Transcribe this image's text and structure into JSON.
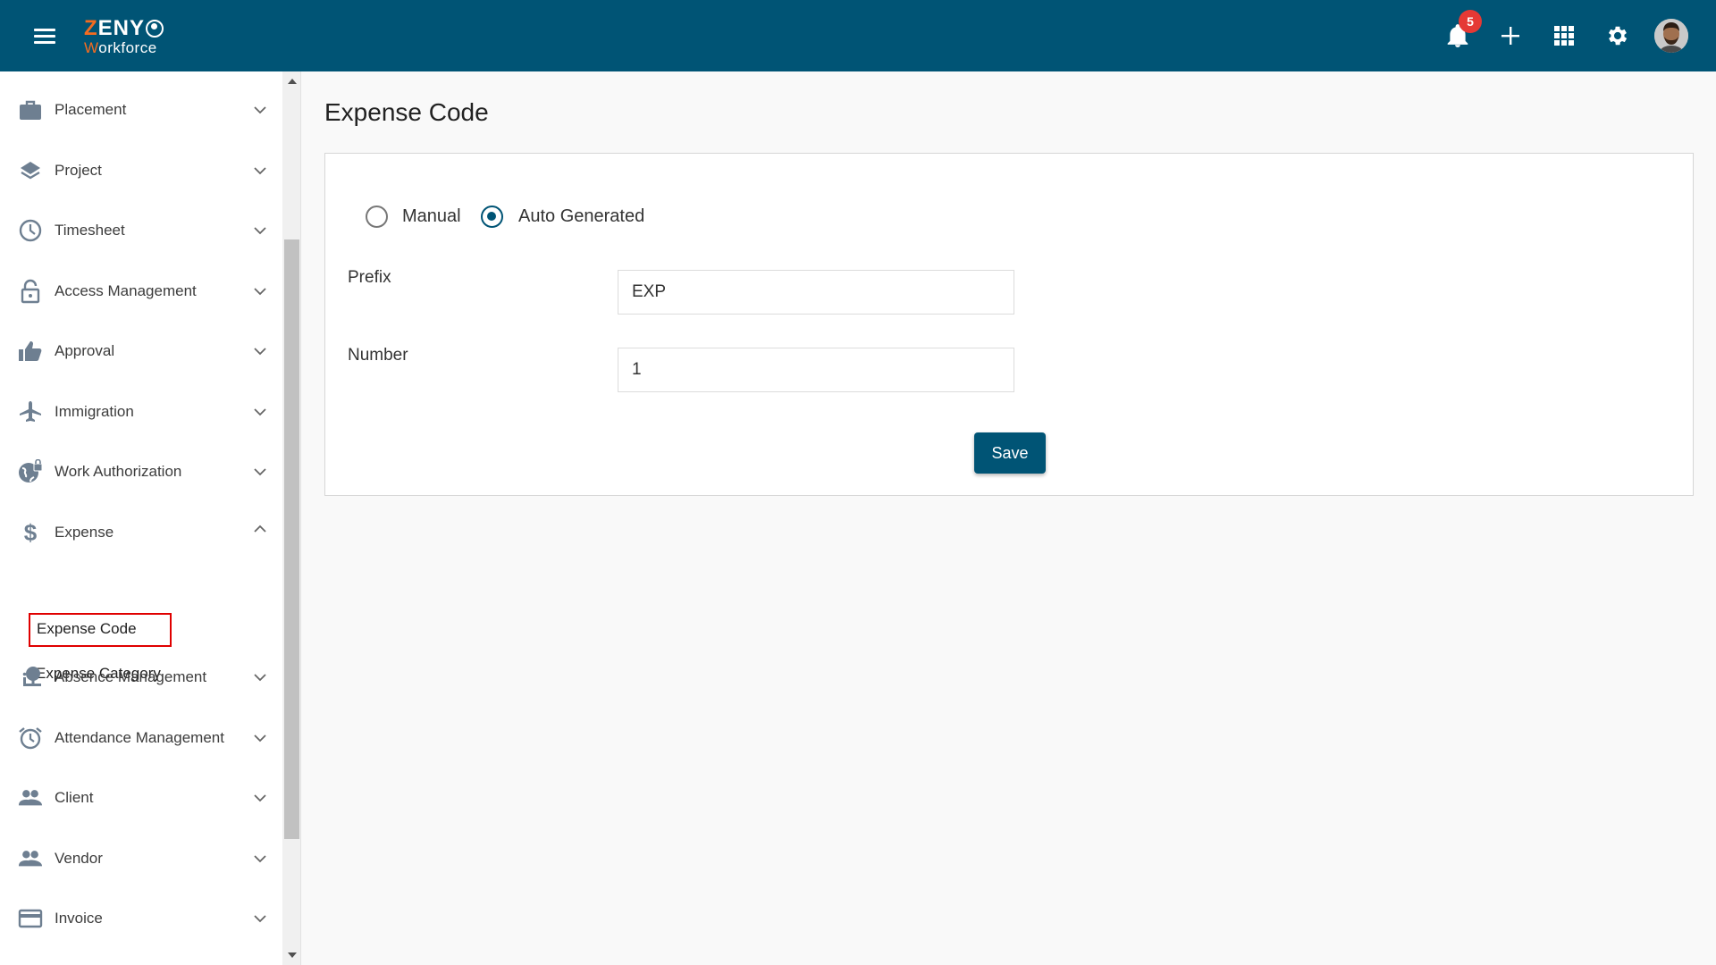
{
  "header": {
    "logo_top_accent": "Z",
    "logo_top_rest": "ENY",
    "logo_bottom_accent": "W",
    "logo_bottom_rest": "orkforce",
    "notification_count": "5",
    "icons": [
      "menu-icon",
      "bell-icon",
      "plus-icon",
      "apps-grid-icon",
      "gear-icon",
      "avatar"
    ],
    "brand_color": "#005475",
    "accent_color": "#f36c21"
  },
  "sidebar": {
    "items": [
      {
        "label": "Placement",
        "icon": "briefcase-icon",
        "expanded": false
      },
      {
        "label": "Project",
        "icon": "layers-icon",
        "expanded": false
      },
      {
        "label": "Timesheet",
        "icon": "clock-icon",
        "expanded": false
      },
      {
        "label": "Access Management",
        "icon": "lock-icon",
        "expanded": false
      },
      {
        "label": "Approval",
        "icon": "thumbs-up-icon",
        "expanded": false
      },
      {
        "label": "Immigration",
        "icon": "airplane-icon",
        "expanded": false
      },
      {
        "label": "Work Authorization",
        "icon": "globe-lock-icon",
        "expanded": false
      },
      {
        "label": "Expense",
        "icon": "dollar-icon",
        "expanded": true
      },
      {
        "label": "Absence Management",
        "icon": "absence-icon",
        "expanded": false
      },
      {
        "label": "Attendance Management",
        "icon": "alarm-clock-icon",
        "expanded": false
      },
      {
        "label": "Client",
        "icon": "people-icon",
        "expanded": false
      },
      {
        "label": "Vendor",
        "icon": "people-icon",
        "expanded": false
      },
      {
        "label": "Invoice",
        "icon": "credit-card-icon",
        "expanded": false
      }
    ],
    "expense_subitems": [
      {
        "label": "Expense Code",
        "active": true
      },
      {
        "label": "Expense Category",
        "active": false
      }
    ]
  },
  "main": {
    "title": "Expense Code",
    "mode_options": [
      {
        "label": "Manual",
        "selected": false
      },
      {
        "label": "Auto Generated",
        "selected": true
      }
    ],
    "fields": [
      {
        "label": "Prefix",
        "value": "EXP"
      },
      {
        "label": "Number",
        "value": "1"
      }
    ],
    "save_label": "Save"
  }
}
